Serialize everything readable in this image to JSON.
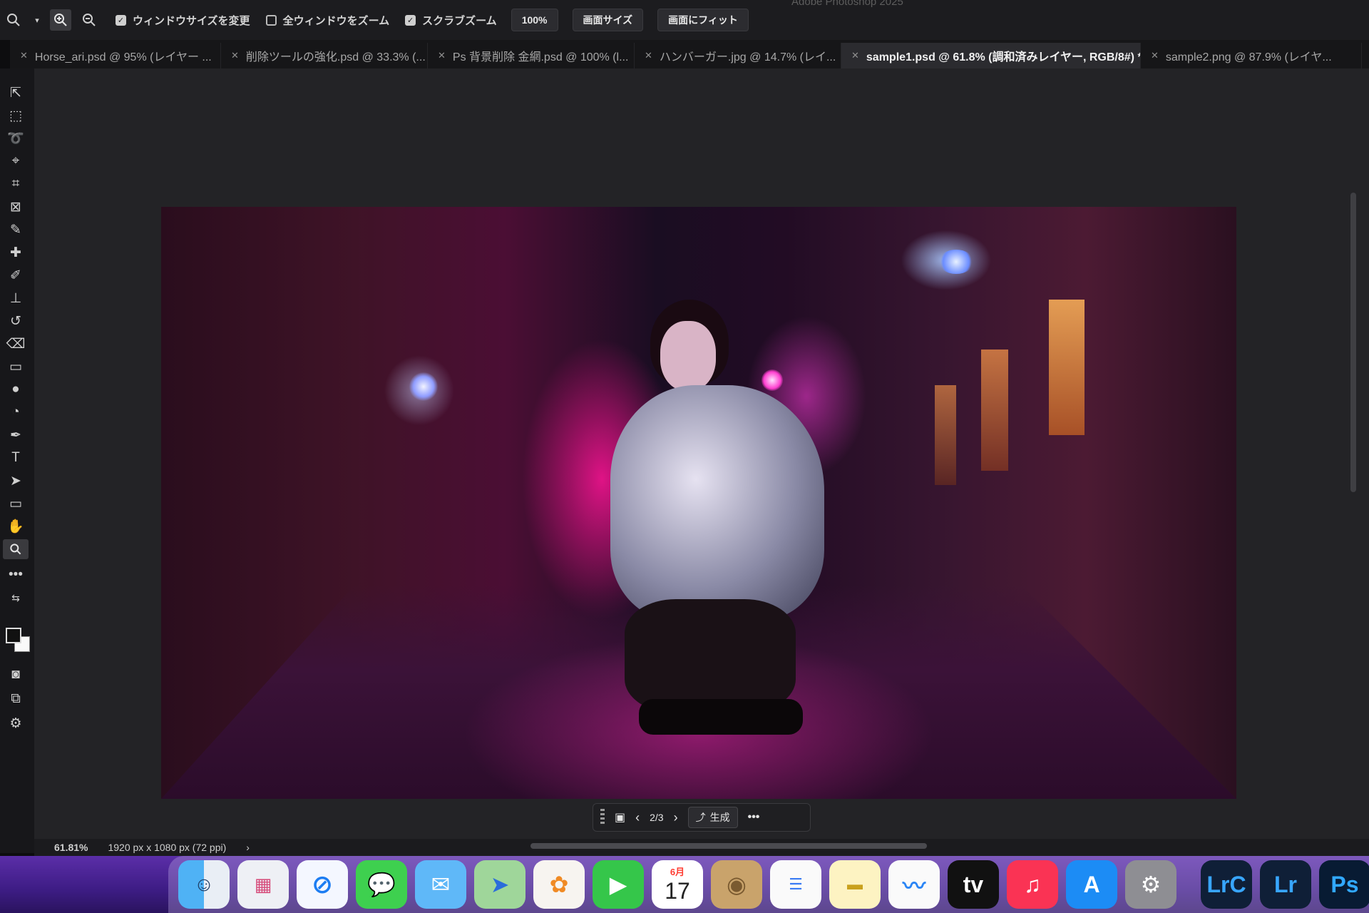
{
  "app": {
    "title": "Adobe Photoshop 2025"
  },
  "options_bar": {
    "checkboxes": [
      {
        "label": "ウィンドウサイズを変更",
        "checked": true
      },
      {
        "label": "全ウィンドウをズーム",
        "checked": false
      },
      {
        "label": "スクラブズーム",
        "checked": true
      }
    ],
    "buttons": [
      "100%",
      "画面サイズ",
      "画面にフィット"
    ]
  },
  "tabs": [
    {
      "label": "Horse_ari.psd @ 95% (レイヤー ...",
      "active": false
    },
    {
      "label": "削除ツールの強化.psd @ 33.3% (...",
      "active": false
    },
    {
      "label": "Ps 背景削除 金網.psd @ 100% (l...",
      "active": false
    },
    {
      "label": "ハンバーガー.jpg @ 14.7% (レイ...",
      "active": false
    },
    {
      "label": "sample1.psd @ 61.8% (調和済みレイヤー, RGB/8#) *",
      "active": true
    },
    {
      "label": "sample2.png @ 87.9% (レイヤ...",
      "active": false
    }
  ],
  "context_bar": {
    "page": "2/3",
    "generate_label": "生成"
  },
  "status": {
    "zoom": "61.81%",
    "doc_info": "1920 px x 1080 px (72 ppi)"
  },
  "dock": {
    "calendar_month": "6月",
    "calendar_day": "17",
    "apps": [
      "finder",
      "launchpad",
      "safari",
      "messages",
      "mail",
      "maps",
      "photos",
      "facetime",
      "calendar",
      "contacts",
      "reminders",
      "notes",
      "freeform",
      "apple-tv",
      "music",
      "app-store",
      "system-settings",
      "lightroom-classic",
      "lightroom",
      "photoshop"
    ],
    "labels": {
      "lrc": "LrC",
      "lr": "Lr",
      "ps": "Ps",
      "tv": "tv"
    }
  }
}
